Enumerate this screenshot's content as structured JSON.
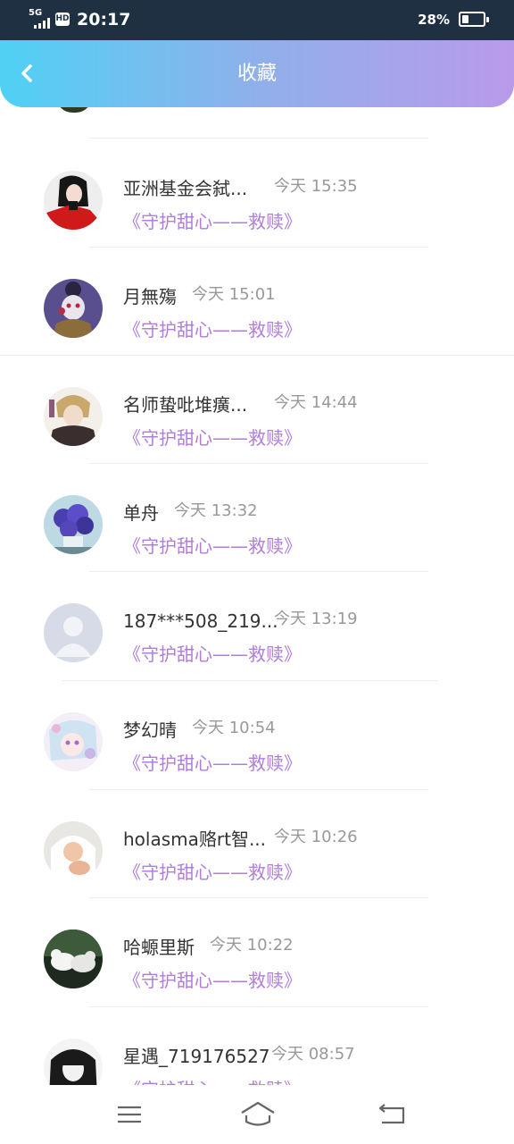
{
  "status_bar": {
    "network": "5G",
    "hd": "HD",
    "time": "20:17",
    "battery": "28%"
  },
  "header": {
    "title": "收藏",
    "back_icon": "chevron-left-icon"
  },
  "items": [
    {
      "name": "亚洲基金会弑...",
      "time": "今天 15:35",
      "title": "《守护甜心——救赎》",
      "avatar": "woman-red-coat"
    },
    {
      "name": "月無殤",
      "time": "今天 15:01",
      "title": "《守护甜心——救赎》",
      "avatar": "anime-dark-clown"
    },
    {
      "name": "名师蛰吡堆癀...",
      "time": "今天 14:44",
      "title": "《守护甜心——救赎》",
      "avatar": "anime-boy"
    },
    {
      "name": "单舟",
      "time": "今天 13:32",
      "title": "《守护甜心——救赎》",
      "avatar": "purple-flowers"
    },
    {
      "name": "187***508_219...",
      "time": "今天 13:19",
      "title": "《守护甜心——救赎》",
      "avatar": "default-person"
    },
    {
      "name": "梦幻晴",
      "time": "今天 10:54",
      "title": "《守护甜心——救赎》",
      "avatar": "anime-pastel-girl"
    },
    {
      "name": "holasma赂rt智...",
      "time": "今天 10:26",
      "title": "《守护甜心——救赎》",
      "avatar": "baby-towel"
    },
    {
      "name": "哈螈里斯",
      "time": "今天 10:22",
      "title": "《守护甜心——救赎》",
      "avatar": "white-doves"
    },
    {
      "name": "星遇_719176527",
      "time": "今天 08:57",
      "title": "《守护甜心——救赎》",
      "avatar": "anime-bw-girl"
    }
  ],
  "nav": {
    "menu_icon": "menu-icon",
    "home_icon": "home-icon",
    "back_icon": "back-arrow-icon"
  }
}
